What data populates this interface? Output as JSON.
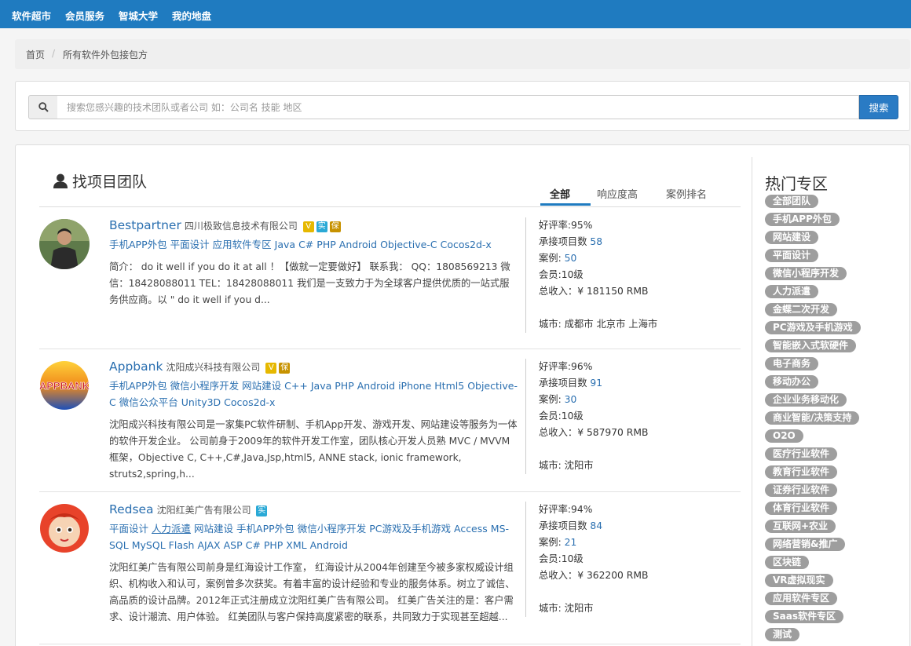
{
  "topnav": {
    "items": [
      "软件超市",
      "会员服务",
      "智城大学",
      "我的地盘"
    ]
  },
  "breadcrumb": {
    "home": "首页",
    "separator": "/",
    "current": "所有软件外包接包方"
  },
  "search": {
    "placeholder": "搜索您感兴趣的技术团队或者公司 如：公司名 技能 地区",
    "value": "",
    "button_label": "搜索"
  },
  "main": {
    "heading": "找项目团队",
    "tabs": [
      {
        "label": "全部",
        "active": true
      },
      {
        "label": "响应度高",
        "active": false
      },
      {
        "label": "案例排名",
        "active": false
      }
    ],
    "teams": [
      {
        "name": "Bestpartner",
        "company": "四川极致信息技术有限公司",
        "badges": [
          "V",
          "实",
          "保"
        ],
        "tags": [
          "手机APP外包",
          "平面设计",
          "应用软件专区",
          "Java",
          "C#",
          "PHP",
          "Android",
          "Objective-C",
          "Cocos2d-x"
        ],
        "description": "简介： do it well if you do it at all ！【做就一定要做好】 联系我： QQ：1808569213 微信：18428088011 TEL：18428088011 我们是一支致力于为全球客户提供优质的一站式服务供应商。以 \" do it well if you d...",
        "stats": {
          "rating_label": "好评率:",
          "rating": "95%",
          "projects_label": "承接项目数",
          "projects": "58",
          "cases_label": "案例:",
          "cases": "50",
          "level_label": "会员:",
          "level": "10级",
          "income_label": "总收入：¥",
          "income": "181150 RMB",
          "city_label": "城市:",
          "city": "成都市 北京市 上海市"
        }
      },
      {
        "name": "Appbank",
        "company": "沈阳成兴科技有限公司",
        "badges": [
          "V",
          "保"
        ],
        "tags": [
          "手机APP外包",
          "微信小程序开发",
          "网站建设",
          "C++",
          "Java",
          "PHP",
          "Android",
          "iPhone",
          "Html5",
          "Objective-C",
          "微信公众平台",
          "Unity3D",
          "Cocos2d-x"
        ],
        "description": "沈阳成兴科技有限公司是一家集PC软件研制、手机App开发、游戏开发、网站建设等服务为一体的软件开发企业。 公司前身于2009年的软件开发工作室，团队核心开发人员熟 MVC / MVVM 框架，Objective C, C++,C#,Java,Jsp,html5, ANNE stack, ionic framework, struts2,spring,h...",
        "stats": {
          "rating_label": "好评率:",
          "rating": "96%",
          "projects_label": "承接项目数",
          "projects": "91",
          "cases_label": "案例:",
          "cases": "30",
          "level_label": "会员:",
          "level": "10级",
          "income_label": "总收入：¥",
          "income": "587970 RMB",
          "city_label": "城市:",
          "city": "沈阳市"
        }
      },
      {
        "name": "Redsea",
        "company": "沈阳红美广告有限公司",
        "badges": [
          "实"
        ],
        "tags": [
          "平面设计",
          "人力派遣",
          "网站建设",
          "手机APP外包",
          "微信小程序开发",
          "PC游戏及手机游戏",
          "Access",
          "MS-SQL",
          "MySQL",
          "Flash",
          "AJAX",
          "ASP",
          "C#",
          "PHP",
          "XML",
          "Android"
        ],
        "description": "沈阳红美广告有限公司前身是红海设计工作室， 红海设计从2004年创建至今被多家权威设计组织、机构收入和认可，案例曾多次获奖。有着丰富的设计经验和专业的服务体系。树立了诚信、高品质的设计品牌。2012年正式注册成立沈阳红美广告有限公司。 红美广告关注的是：客户需求、设计潮流、用户体验。 红美团队与客户保持高度紧密的联系，共同致力于实现甚至超越...",
        "stats": {
          "rating_label": "好评率:",
          "rating": "94%",
          "projects_label": "承接项目数",
          "projects": "84",
          "cases_label": "案例:",
          "cases": "21",
          "level_label": "会员:",
          "level": "10级",
          "income_label": "总收入：¥",
          "income": "362200 RMB",
          "city_label": "城市:",
          "city": "沈阳市"
        }
      }
    ]
  },
  "sidebar": {
    "title": "热门专区",
    "tags": [
      "全部团队",
      "手机APP外包",
      "网站建设",
      "平面设计",
      "微信小程序开发",
      "人力派遣",
      "金蝶二次开发",
      "PC游戏及手机游戏",
      "智能嵌入式软硬件",
      "电子商务",
      "移动办公",
      "企业业务移动化",
      "商业智能/决策支持",
      "O2O",
      "医疗行业软件",
      "教育行业软件",
      "证券行业软件",
      "体育行业软件",
      "互联网+农业",
      "网络营销&推广",
      "区块链",
      "VR虚拟现实",
      "应用软件专区",
      "Saas软件专区",
      "测试"
    ]
  },
  "colors": {
    "nav_bg": "#1f7bc0",
    "link": "#2a6fb0",
    "tag_bg": "#9e9e9e",
    "search_btn": "#2a7bc4"
  }
}
